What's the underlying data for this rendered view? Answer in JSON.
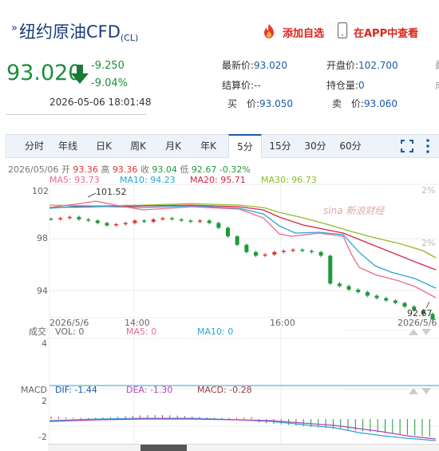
{
  "header": {
    "title": "纽约原油CFD",
    "title_suffix": "(CL)",
    "add_watch": "添加自选",
    "app_view": "在APP中查看"
  },
  "quote": {
    "price": "93.020",
    "change": "-9.250",
    "change_pct": "-9.04%",
    "timestamp": "2026-05-06 18:01:48",
    "latest_label": "最新价:",
    "latest_value": "93.020",
    "open_label": "开盘价:",
    "open_value": "102.700",
    "settle_label": "结算价:",
    "settle_value": "--",
    "oi_label": "持仓量:",
    "oi_value": "0",
    "bid_label": "买　价:",
    "bid_value": "93.050",
    "ask_label": "卖　价:",
    "ask_value": "93.060"
  },
  "tabs": [
    "分时",
    "年线",
    "日K",
    "周K",
    "月K",
    "年K",
    "5分",
    "15分",
    "30分",
    "60分"
  ],
  "active_tab": "5分",
  "ohlc": {
    "date": "2026/05/06",
    "open_label": "开",
    "open": "93.36",
    "high_label": "高",
    "high": "93.36",
    "close_label": "收",
    "close": "93.04",
    "low_label": "低",
    "low": "92.67",
    "pct": "-0.32%"
  },
  "ma": {
    "ma5": "MA5: 93.73",
    "ma10": "MA10: 94.23",
    "ma20": "MA20: 95.71",
    "ma30": "MA30: 96.73"
  },
  "colors": {
    "up": "#e2322d",
    "down": "#1d9a3a",
    "ma5": "#e96b8c",
    "ma10": "#2aa6d6",
    "ma20": "#d6264a",
    "ma30": "#8fbc27",
    "accent": "#1b5aa6"
  },
  "price_axis": {
    "ticks": [
      "102",
      "98",
      "94"
    ],
    "pct_ticks": [
      "2%",
      "2%"
    ],
    "high_mark": "101.52",
    "low_mark": "92.67"
  },
  "time_axis": {
    "start": "2026/5/6",
    "mid1": "14:00",
    "mid2": "16:00",
    "end": "2026/5/6"
  },
  "volume": {
    "label": "成交",
    "vol": "VOL: 0",
    "ma5": "MA5: 0",
    "ma10": "MA10: 0",
    "tick": "4"
  },
  "macd": {
    "label": "MACD",
    "dif": "DIF: -1.44",
    "dea": "DEA: -1.30",
    "macd": "MACD: -0.28",
    "tick_top": "2",
    "tick_bottom": "-2"
  },
  "chart_data": {
    "type": "candlestick",
    "x_range": [
      "13:10",
      "18:00"
    ],
    "ylim": [
      92,
      103
    ],
    "ytick_values": [
      102,
      98,
      94
    ],
    "high": 101.52,
    "low": 92.67,
    "close_series": [
      101.3,
      101.4,
      101.5,
      101.3,
      101.2,
      101.0,
      100.8,
      100.9,
      101.0,
      101.2,
      101.1,
      101.3,
      101.4,
      101.3,
      101.2,
      101.1,
      101.2,
      101.0,
      100.6,
      99.9,
      99.2,
      98.6,
      98.3,
      98.4,
      98.6,
      98.7,
      98.8,
      98.7,
      98.6,
      98.3,
      96.0,
      95.8,
      95.5,
      95.3,
      95.0,
      94.8,
      94.6,
      94.4,
      94.1,
      93.8,
      93.5,
      93.04
    ]
  }
}
